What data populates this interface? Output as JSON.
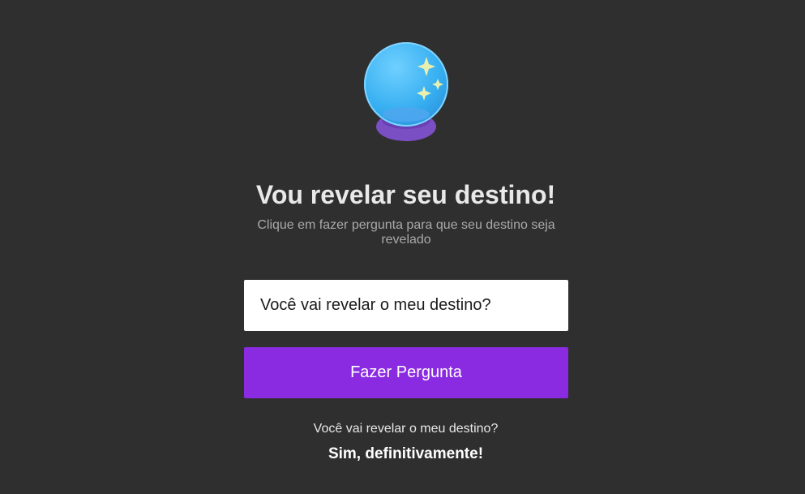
{
  "header": {
    "icon": "crystal-ball-icon",
    "title": "Vou revelar seu destino!",
    "subtitle": "Clique em fazer pergunta para que seu destino seja revelado"
  },
  "form": {
    "question_value": "Você vai revelar o meu destino?",
    "ask_button_label": "Fazer Pergunta"
  },
  "result": {
    "question": "Você vai revelar o meu destino?",
    "answer": "Sim, definitivamente!"
  },
  "colors": {
    "background": "#2f2f30",
    "accent": "#8a2be2",
    "orb": "#42b4f5",
    "orb_base": "#7b4fc4"
  }
}
